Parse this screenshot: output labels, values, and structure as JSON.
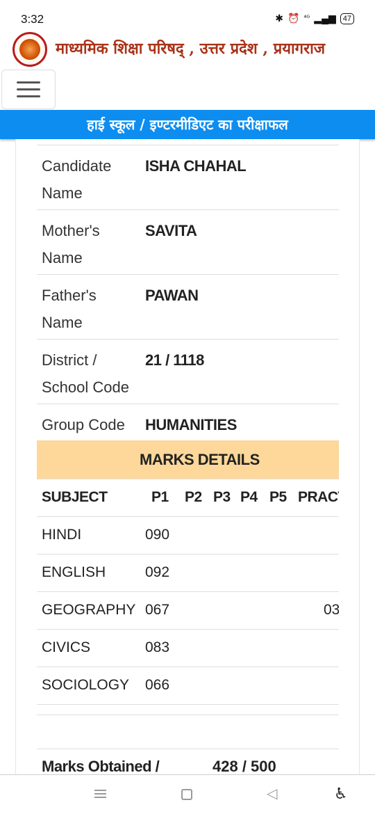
{
  "status_bar": {
    "time": "3:32",
    "bluetooth": "✱",
    "alarm": "⏰",
    "network": "⁴ᴳ",
    "signal": "▂▄▆",
    "battery": "47"
  },
  "header": {
    "title": "माध्यमिक शिक्षा परिषद् , उत्तर प्रदेश , प्रयागराज"
  },
  "banner": {
    "text": "हाई स्कूल / इण्टरमीडिएट का परीक्षाफल"
  },
  "candidate": [
    {
      "label_line1": "Candidate",
      "label_line2": "Name",
      "value": "ISHA CHAHAL"
    },
    {
      "label_line1": "Mother's",
      "label_line2": "Name",
      "value": "SAVITA"
    },
    {
      "label_line1": "Father's",
      "label_line2": "Name",
      "value": "PAWAN"
    },
    {
      "label_line1": "District /",
      "label_line2": "School Code",
      "value": "21 / 1118"
    },
    {
      "label_line1": "Group Code",
      "label_line2": "",
      "value": "HUMANITIES"
    }
  ],
  "marks": {
    "heading": "MARKS DETAILS",
    "columns": [
      "SUBJECT",
      "P1",
      "P2",
      "P3",
      "P4",
      "P5",
      "PRACT"
    ],
    "rows": [
      {
        "subject": "HINDI",
        "p1": "090",
        "pract": ""
      },
      {
        "subject": "ENGLISH",
        "p1": "092",
        "pract": ""
      },
      {
        "subject": "GEOGRAPHY",
        "p1": "067",
        "pract": "03"
      },
      {
        "subject": "CIVICS",
        "p1": "083",
        "pract": ""
      },
      {
        "subject": "SOCIOLOGY",
        "p1": "066",
        "pract": ""
      }
    ]
  },
  "summary": {
    "label": "Marks Obtained /",
    "value": "428 / 500"
  },
  "nav": {
    "back": "◁",
    "accessibility": "♿"
  }
}
